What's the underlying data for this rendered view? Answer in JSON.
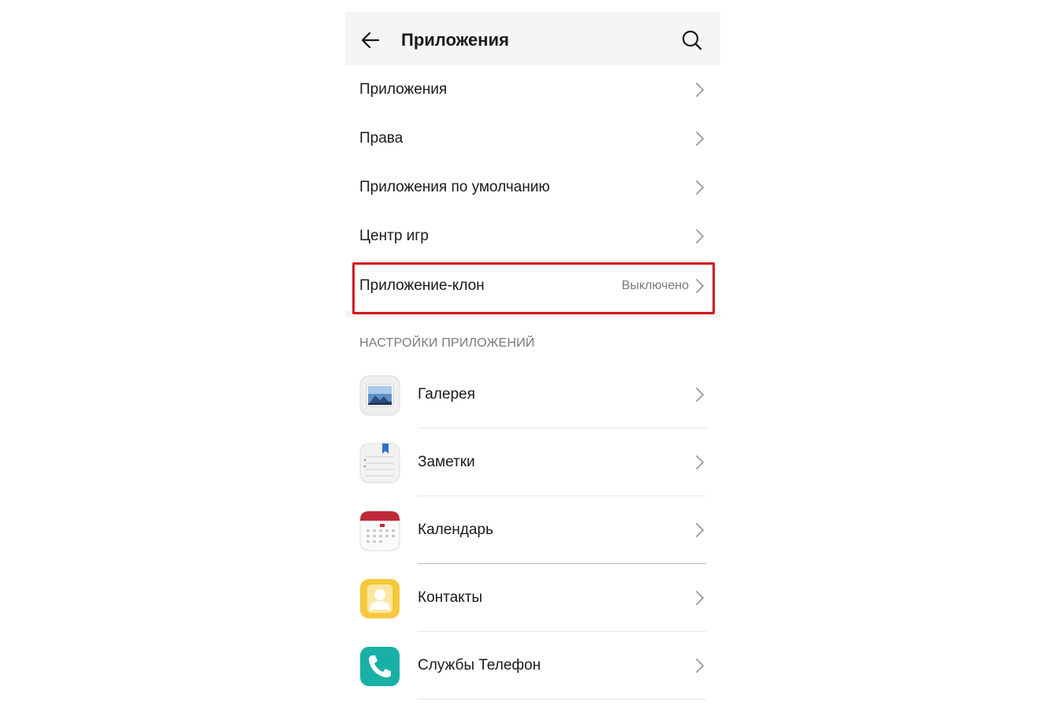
{
  "header": {
    "title": "Приложения",
    "back_icon": "arrow-left-icon",
    "search_icon": "search-icon"
  },
  "menu": {
    "items": [
      {
        "label": "Приложения"
      },
      {
        "label": "Права"
      },
      {
        "label": "Приложения по умолчанию"
      },
      {
        "label": "Центр игр"
      },
      {
        "label": "Приложение-клон",
        "value": "Выключено",
        "highlighted": true
      }
    ]
  },
  "app_settings": {
    "section_title": "НАСТРОЙКИ ПРИЛОЖЕНИЙ",
    "apps": [
      {
        "label": "Галерея",
        "icon": "gallery-icon"
      },
      {
        "label": "Заметки",
        "icon": "notes-icon"
      },
      {
        "label": "Календарь",
        "icon": "calendar-icon"
      },
      {
        "label": "Контакты",
        "icon": "contacts-icon"
      },
      {
        "label": "Службы Телефон",
        "icon": "phone-icon"
      }
    ]
  },
  "colors": {
    "highlight_border": "#d4141c",
    "header_bg": "#f5f5f5",
    "secondary_text": "#7a7a7a"
  }
}
